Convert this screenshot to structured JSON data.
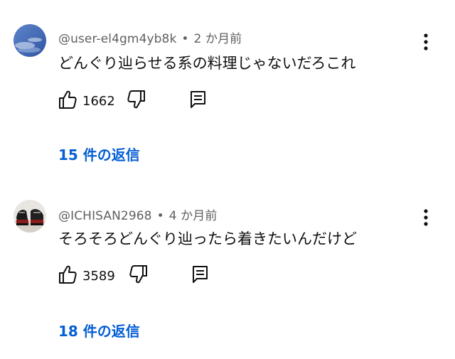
{
  "comments": [
    {
      "username": "@user-el4gm4yb8k",
      "separator": "•",
      "time": "2 か月前",
      "text": "どんぐり辿らせる系の料理じゃないだろこれ",
      "likes": "1662",
      "replies_label": "15 件の返信",
      "avatar_icon": "sky-photo-avatar"
    },
    {
      "username": "@ICHISAN2968",
      "separator": "•",
      "time": "4 か月前",
      "text": "そろそろどんぐり辿ったら着きたいんだけど",
      "likes": "3589",
      "replies_label": "18 件の返信",
      "avatar_icon": "shoes-photo-avatar"
    }
  ],
  "icons": {
    "like": "thumbs-up-icon",
    "dislike": "thumbs-down-icon",
    "reply": "reply-comment-icon",
    "more": "more-vert-icon"
  },
  "colors": {
    "link_blue": "#065fd4",
    "meta_gray": "#606060",
    "text": "#0f0f0f"
  }
}
